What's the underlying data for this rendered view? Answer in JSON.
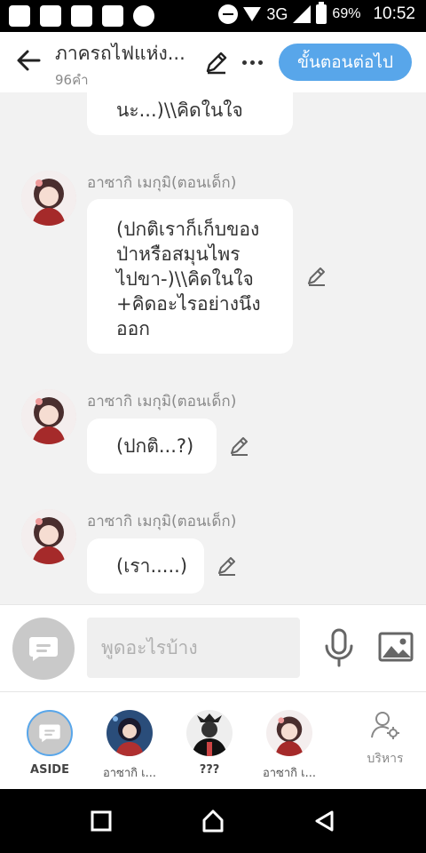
{
  "status_bar": {
    "network": "3G",
    "battery": "69%",
    "time": "10:52",
    "left_icons": [
      "messages-icon",
      "facebook-icon",
      "chat-icon",
      "gallery-icon",
      "messenger-icon"
    ]
  },
  "header": {
    "title": "ภาครถไฟแห่ง...",
    "word_count": "96คำ",
    "next_button": "ขั้นตอนต่อไป"
  },
  "messages": [
    {
      "sender": "",
      "text": "นะ...)\\\\คิดในใจ"
    },
    {
      "sender": "อาซากิ เมกุมิ(ตอนเด็ก)",
      "text": "(ปกติเราก็เก็บของ\nป่าหรือสมุนไพร\nไปขา-)\\\\คิดในใจ\n+คิดอะไรอย่างนึง\nออก"
    },
    {
      "sender": "อาซากิ เมกุมิ(ตอนเด็ก)",
      "text": "(ปกติ...?)"
    },
    {
      "sender": "อาซากิ เมกุมิ(ตอนเด็ก)",
      "text": "(เรา.....)"
    }
  ],
  "input": {
    "placeholder": "พูดอะไรบ้าง",
    "value": ""
  },
  "characters": [
    {
      "label": "ASIDE"
    },
    {
      "label": "อาซากิ เ..."
    },
    {
      "label": "???"
    },
    {
      "label": "อาซากิ เ..."
    }
  ],
  "manage_label": "บริหาร",
  "colors": {
    "accent": "#58a6ea",
    "background": "#f2f2f2",
    "bubble": "#ffffff"
  }
}
